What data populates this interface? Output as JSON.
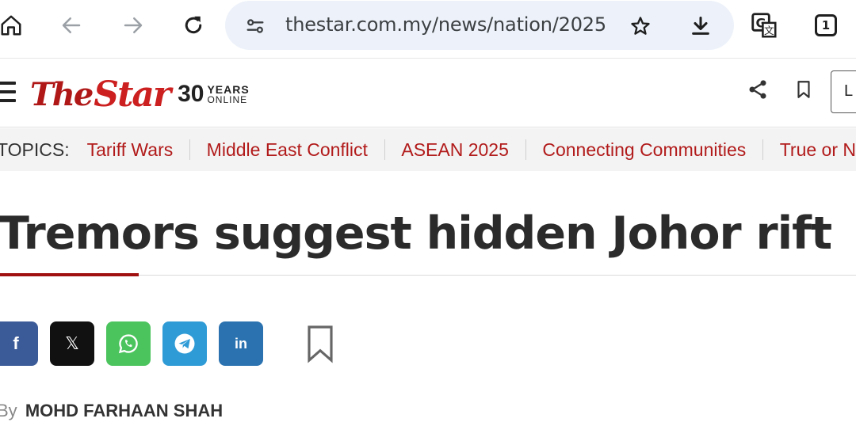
{
  "browser": {
    "url": "thestar.com.my/news/nation/2025",
    "tab_count": "1",
    "icons": [
      "home-icon",
      "back-icon",
      "forward-icon",
      "reload-icon",
      "site-settings-icon",
      "star-icon",
      "download-icon",
      "translate-icon",
      "tab-switcher-icon"
    ]
  },
  "header": {
    "logo_the": "The",
    "logo_star": "Star",
    "logo_30": "30",
    "logo_years": "YEARS",
    "logo_online": "ONLINE",
    "login_label": "L",
    "brand_color": "#cc1f1f"
  },
  "topics": {
    "label": "TOPICS:",
    "items": [
      "Tariff Wars",
      "Middle East Conflict",
      "ASEAN 2025",
      "Connecting Communities",
      "True or N"
    ]
  },
  "article": {
    "headline": "Tremors suggest hidden Johor rift",
    "byline_prefix": "By",
    "author": "MOHD FARHAAN SHAH",
    "share_buttons": [
      {
        "name": "facebook",
        "glyph": "f",
        "color": "#3b5a98"
      },
      {
        "name": "x",
        "glyph": "𝕏",
        "color": "#111111"
      },
      {
        "name": "whatsapp",
        "glyph": "",
        "color": "#4cc45e"
      },
      {
        "name": "telegram",
        "glyph": "",
        "color": "#2f9bd6"
      },
      {
        "name": "linkedin",
        "glyph": "in",
        "color": "#2a72b0"
      }
    ]
  }
}
